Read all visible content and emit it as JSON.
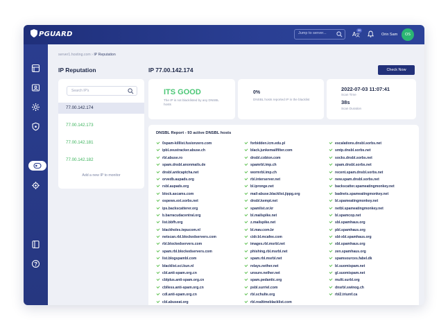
{
  "header": {
    "logo_text": "PGUARD",
    "search_placeholder": "Jump to server...",
    "notification_count": "99",
    "user_name": "Orin Sam",
    "avatar_initials": "OS"
  },
  "sidebar": {
    "items": [
      {
        "icon": "server-icon"
      },
      {
        "icon": "image-icon"
      },
      {
        "icon": "settings-gear-icon"
      },
      {
        "icon": "shield-icon"
      },
      {
        "icon": "ip-reputation-icon",
        "active": true
      },
      {
        "icon": "gear-icon"
      },
      {
        "icon": "panel-icon"
      },
      {
        "icon": "help-icon"
      }
    ]
  },
  "breadcrumb": {
    "parent": "server1.hosting.com",
    "separator": "›",
    "current": "IP Reputation"
  },
  "page": {
    "title": "IP Reputation",
    "selected_ip_title": "IP 77.00.142.174",
    "check_now_label": "Check Now"
  },
  "ip_list": {
    "search_placeholder": "Search IP's",
    "items": [
      "77.00.142.174",
      "77.00.142.173",
      "77.00.142.181",
      "77.00.142.182"
    ],
    "add_label": "Add a new IP to monitor"
  },
  "status": {
    "title": "ITS GOOD",
    "subtitle": "The IP is not blacklisted by any DNSBL hosts",
    "percent": "0%",
    "percent_label": "DNSBL hosts reported IP in the blacklist",
    "scan_time": "2022-07-03 11:07:41",
    "scan_time_label": "Scan Time",
    "scan_duration": "38s",
    "scan_duration_label": "Scan Duration"
  },
  "colors": {
    "accent": "#22317a",
    "good": "#4cc776",
    "check": "#5cc04f",
    "avatar": "#2bb673"
  },
  "report": {
    "title": "DNSBL Report - 93 active DNSBL hosts",
    "columns": [
      [
        "0spam-killlist.fusionzero.com",
        "ipbl.zeustracker.abuse.ch",
        "rbl.abuse.ro",
        "spam.dnsbl.anonmails.de",
        "dnsbl.anticaptcha.net",
        "orvedb.aupads.org",
        "rsbl.aupads.org",
        "block.ascams.com",
        "ospews.ext.sorbs.net",
        "ips.backscatterer.org",
        "b.barracudacentral.org",
        "list.bbfh.org",
        "blackholes.tepucom.nl",
        "netscan.rbl.blockedservers.com",
        "rbl.blockedservers.com",
        "spam.rbl.blockedservers.com",
        "list.blogspambl.com",
        "blacklist.sci.kun.nl",
        "cbl.anti-spam.org.cn",
        "cblplus.anti-spam.org.cn",
        "cblless.anti-spam.org.cn",
        "cdl.anti-spam.org.cn",
        "cbl.abuseat.org"
      ],
      [
        "forbidden.icm.edu.pl",
        "black.junkemailfilter.com",
        "dnsbl.cobion.com",
        "spamrbl.imp.ch",
        "wormrbl.imp.ch",
        "rbl.interserver.net",
        "bl.ipronge.net",
        "mail-abuse.blacklist.jippg.org",
        "dnsbl.kempt.net",
        "spamlist.or.kr",
        "bl.mailspike.net",
        "z.mailspike.net",
        "bl.mav.com.br",
        "cidr.bl.mcafee.com",
        "images.rbl.msrbl.net",
        "phishing.rbl.msrbl.net",
        "spam.rbl.msrbl.net",
        "relays.nether.net",
        "unsure.nether.net",
        "spam.pedantic.org",
        "psbl.surriel.com",
        "rbl.schulte.org",
        "rbl.realtimeblacklist.com"
      ],
      [
        "escalations.dnsbl.sorbs.net",
        "smtp.dnsbl.sorbs.net",
        "socks.dnsbl.sorbs.net",
        "spam.dnsbl.sorbs.net",
        "recent.spam.dnsbl.sorbs.net",
        "new.spam.dnsbl.sorbs.net",
        "backscatter.spameatingmonkey.net",
        "badnets.spameatingmonkey.net",
        "bl.spameatingmonkey.net",
        "netbl.spameatingmonkey.net",
        "bl.spamcop.net",
        "sbl.spamhaus.org",
        "pbl.spamhaus.org",
        "sbl-xbl.spamhaus.org",
        "xbl.spamhaus.org",
        "zen.spamhaus.org",
        "spamsources.fabel.dk",
        "bl.suomispam.net",
        "gl.suomispam.net",
        "multi.surbl.org",
        "dnsrbl.swinog.ch",
        "rbl2.triumf.ca"
      ]
    ]
  }
}
